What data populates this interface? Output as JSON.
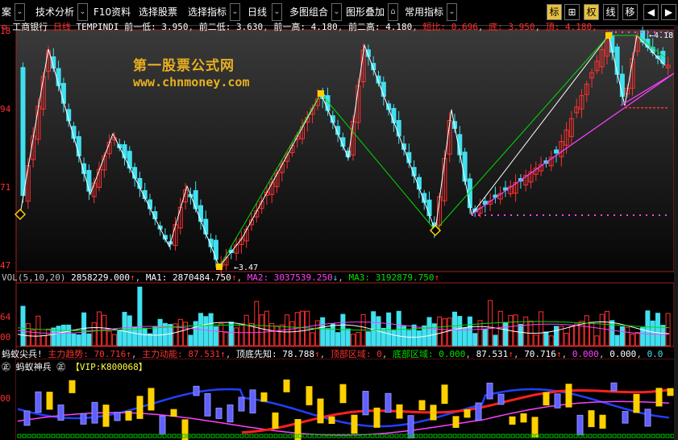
{
  "toolbar": {
    "items": [
      "案",
      "技术分析",
      "F10资料",
      "选择股票",
      "选择指标",
      "日线",
      "多图组合",
      "图形叠加",
      "常用指标"
    ],
    "right_buttons": [
      "标",
      "⊞",
      "权",
      "线",
      "移"
    ]
  },
  "header": {
    "stock_name": "工商银行",
    "period": "日线",
    "indicator": "TEMPINDI",
    "prev_low1": "前一低: 3.950",
    "prev_low2": "前二低: 3.630",
    "prev_high1": "前一高: 4.180",
    "prev_high2": "前二高: 4.180",
    "ratio": "短比: 0.696",
    "bottom": "底: 3.950",
    "top": "頂: 4.180,"
  },
  "main_axis": [
    "18",
    "94",
    "71",
    "47"
  ],
  "main_annotations": {
    "low_label": "3.47",
    "high_label": "4.18"
  },
  "watermark": {
    "title": "第一股票公式网",
    "url": "www.chnmoney.com"
  },
  "vol": {
    "label": "VOL(5,10,20)",
    "vol_value": "2858229.000",
    "ma1": "MA1: 2870484.750",
    "ma2": "MA2: 3037539.250",
    "ma3": "MA3: 3192879.750",
    "axis": [
      "64",
      "00"
    ]
  },
  "ind1": {
    "label": "蚂蚁尖兵!",
    "trend": "主力趋势: 70.716",
    "power": "主力动能: 87.531",
    "bottom_first": "顶底先知: 78.788",
    "top_zone": "顶部区域: 0",
    "bottom_zone": "底部区域: 0.000",
    "v1": "87.531",
    "v2": "70.716",
    "v3": "0.000",
    "v4": "0.000",
    "v5": "0.0"
  },
  "ind2": {
    "label": "蚂蚁神兵",
    "vip": "【VIP:K800068】",
    "axis": [
      "00"
    ]
  },
  "colors": {
    "up": "#ff3030",
    "down": "#40e0f0",
    "zigzag_white": "#ffffff",
    "zigzag_green": "#00e000",
    "trend_magenta": "#ff40ff",
    "accent_yellow": "#e8c040"
  }
}
